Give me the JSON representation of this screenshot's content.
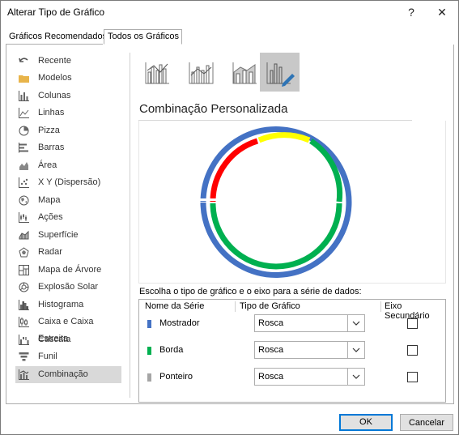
{
  "window": {
    "title": "Alterar Tipo de Gráfico",
    "help": "?",
    "close": "✕"
  },
  "tabs": [
    {
      "label": "Gráficos Recomendados"
    },
    {
      "label": "Todos os Gráficos"
    }
  ],
  "sidebar": {
    "items": [
      {
        "label": "Recente",
        "icon": "undo-arrow-icon"
      },
      {
        "label": "Modelos",
        "icon": "folder-icon"
      },
      {
        "label": "Colunas",
        "icon": "column-chart-icon"
      },
      {
        "label": "Linhas",
        "icon": "line-chart-icon"
      },
      {
        "label": "Pizza",
        "icon": "pie-chart-icon"
      },
      {
        "label": "Barras",
        "icon": "bar-chart-icon"
      },
      {
        "label": "Área",
        "icon": "area-chart-icon"
      },
      {
        "label": "X Y (Dispersão)",
        "icon": "scatter-chart-icon"
      },
      {
        "label": "Mapa",
        "icon": "map-chart-icon"
      },
      {
        "label": "Ações",
        "icon": "stock-chart-icon"
      },
      {
        "label": "Superfície",
        "icon": "surface-chart-icon"
      },
      {
        "label": "Radar",
        "icon": "radar-chart-icon"
      },
      {
        "label": "Mapa de Árvore",
        "icon": "treemap-chart-icon"
      },
      {
        "label": "Explosão Solar",
        "icon": "sunburst-chart-icon"
      },
      {
        "label": "Histograma",
        "icon": "histogram-chart-icon"
      },
      {
        "label": "Caixa e Caixa Estreita",
        "icon": "box-whisker-chart-icon"
      },
      {
        "label": "Cascata",
        "icon": "waterfall-chart-icon"
      },
      {
        "label": "Funil",
        "icon": "funnel-chart-icon"
      },
      {
        "label": "Combinação",
        "icon": "combo-chart-icon"
      }
    ],
    "selected": "Combinação"
  },
  "combo_types": [
    {
      "icon": "clustered-column-line-icon"
    },
    {
      "icon": "clustered-column-line-secondary-icon"
    },
    {
      "icon": "stacked-area-clustered-column-icon"
    },
    {
      "icon": "custom-combination-icon",
      "selected": true
    }
  ],
  "main": {
    "section_title": "Combinação Personalizada",
    "series_caption": "Escolha o tipo de gráfico e o eixo para a série de dados:"
  },
  "series_table": {
    "headers": {
      "name": "Nome da Série",
      "type": "Tipo de Gráfico",
      "secondary": "Eixo Secundário"
    },
    "rows": [
      {
        "name": "Mostrador",
        "type": "Rosca",
        "secondary": false,
        "color": "#4472c4"
      },
      {
        "name": "Borda",
        "type": "Rosca",
        "secondary": false,
        "color": "#00b050"
      },
      {
        "name": "Ponteiro",
        "type": "Rosca",
        "secondary": false,
        "color": "#a5a5a5"
      }
    ]
  },
  "buttons": {
    "ok": "OK",
    "cancel": "Cancelar"
  },
  "colors": {
    "blue": "#4472c4",
    "green": "#00b050",
    "red": "#ff0000",
    "yellow": "#ffff00",
    "selected_bg": "#d9d9d9",
    "focus": "#0078d7"
  }
}
